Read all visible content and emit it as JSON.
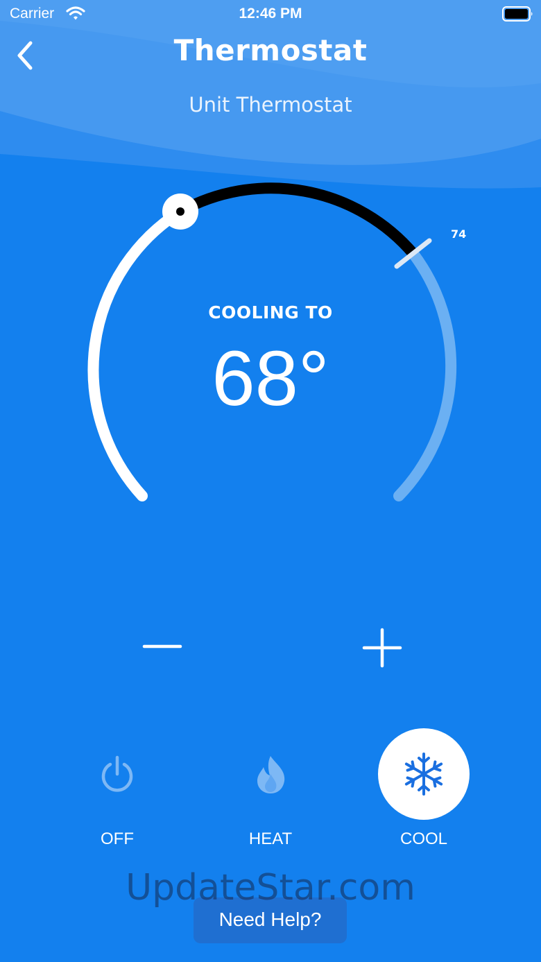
{
  "status_bar": {
    "carrier": "Carrier",
    "time": "12:46 PM"
  },
  "header": {
    "title": "Thermostat",
    "subtitle": "Unit Thermostat"
  },
  "dial": {
    "status": "COOLING TO",
    "setpoint": "68°",
    "current_marker_label": "74"
  },
  "modes": [
    {
      "label": "OFF",
      "icon": "power-icon",
      "active": false
    },
    {
      "label": "HEAT",
      "icon": "flame-icon",
      "active": false
    },
    {
      "label": "COOL",
      "icon": "snowflake-icon",
      "active": true
    }
  ],
  "help": {
    "label": "Need Help?"
  },
  "watermark": "UpdateStar.com",
  "colors": {
    "background": "#1380EE",
    "header_light": "#4A9BF0",
    "arc_active": "#000000",
    "arc_white": "#FFFFFF",
    "arc_faded": "#6BB0F3",
    "icon_inactive": "#7DB8F5",
    "cool_icon": "#1A6FE0"
  }
}
